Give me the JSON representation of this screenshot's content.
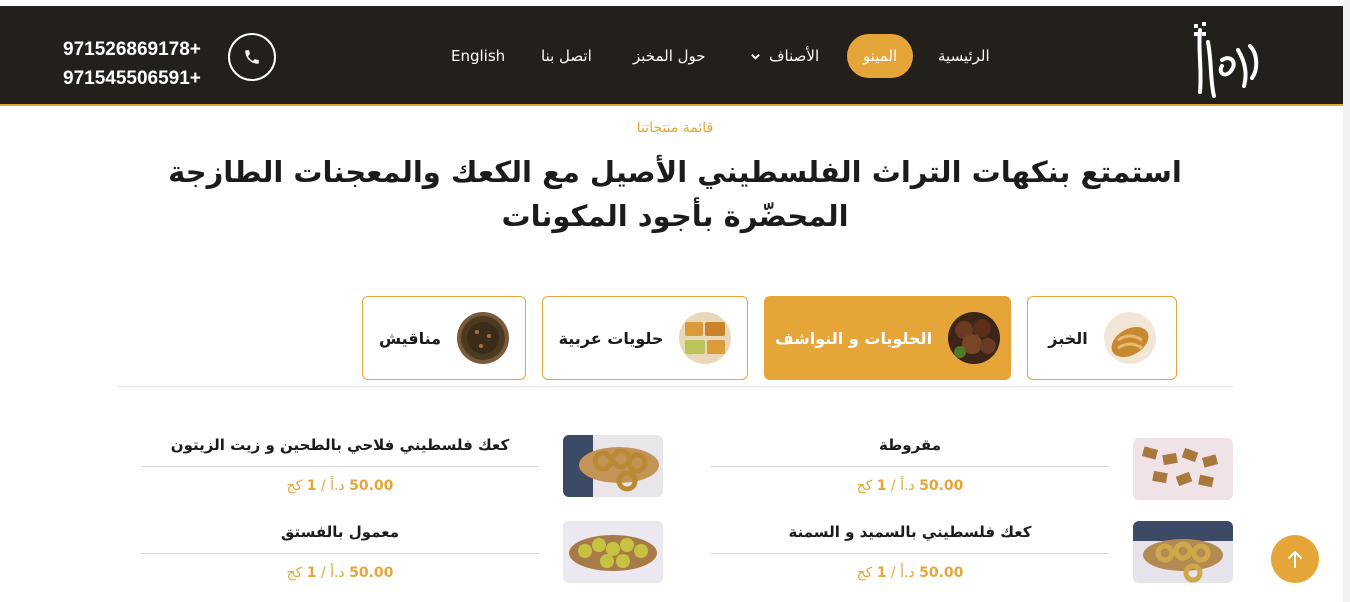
{
  "header": {
    "phones": [
      "97152686917​8+",
      "971545506591+"
    ],
    "nav": {
      "home": "الرئيسية",
      "menu": "المينو",
      "categories": "الأصناف",
      "about": "حول المخبز",
      "contact": "اتصل بنا",
      "language": "English"
    },
    "logo_text": "الكوفية"
  },
  "section": {
    "eyebrow": "قائمة منتجاتنا",
    "title": "استمتع بنكهات التراث الفلسطيني الأصيل مع الكعك والمعجنات الطازجة المحضّرة بأجود المكونات"
  },
  "categories": [
    {
      "label": "الخبز",
      "active": false
    },
    {
      "label": "الحلويات و النواشف",
      "active": true
    },
    {
      "label": "حلويات عربية",
      "active": false
    },
    {
      "label": "مناقيش",
      "active": false
    }
  ],
  "products": [
    {
      "name": "مقروطة",
      "price": "50.00",
      "currency": "د.أ",
      "unit": "1",
      "unit_label": "كج"
    },
    {
      "name": "كعك فلسطيني فلاحي بالطحين و زيت الزيتون",
      "price": "50.00",
      "currency": "د.أ",
      "unit": "1",
      "unit_label": "كج"
    },
    {
      "name": "كعك فلسطيني بالسميد و السمنة",
      "price": "50.00",
      "currency": "د.أ",
      "unit": "1",
      "unit_label": "كج"
    },
    {
      "name": "معمول بالفستق",
      "price": "50.00",
      "currency": "د.أ",
      "unit": "1",
      "unit_label": "كج"
    }
  ],
  "colors": {
    "accent": "#e6a539",
    "header_bg": "#231f1b",
    "text": "#1b1b1b"
  },
  "icons": {
    "phone": "phone-icon",
    "chevron": "chevron-down-icon",
    "scroll_top": "arrow-up-icon"
  }
}
